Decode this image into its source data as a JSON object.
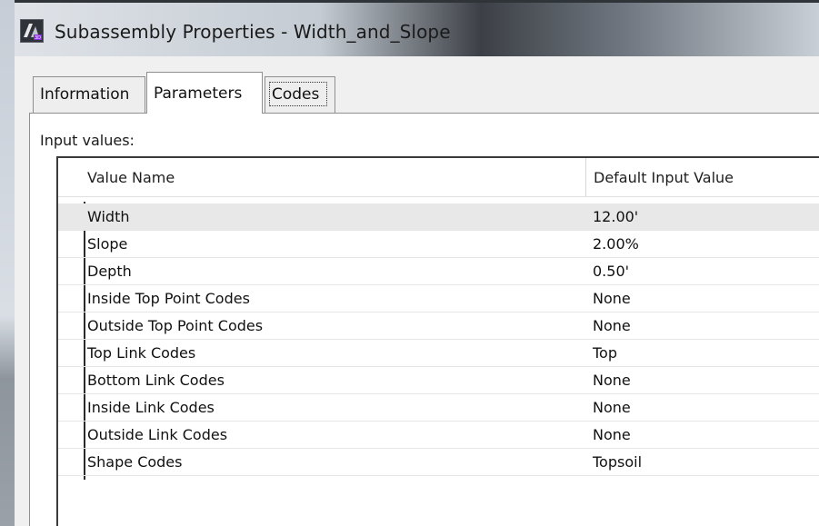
{
  "window": {
    "title": "Subassembly Properties - Width_and_Slope",
    "app_icon": "autocad-civil-icon"
  },
  "tabs": [
    {
      "label": "Information",
      "active": false
    },
    {
      "label": "Parameters",
      "active": true
    },
    {
      "label": "Codes",
      "active": false
    }
  ],
  "parameters": {
    "section_label": "Input values:",
    "columns": {
      "name": "Value Name",
      "value": "Default Input Value"
    },
    "rows": [
      {
        "name": "Width",
        "value": "12.00'",
        "selected": true
      },
      {
        "name": "Slope",
        "value": "2.00%",
        "selected": false
      },
      {
        "name": "Depth",
        "value": "0.50'",
        "selected": false
      },
      {
        "name": "Inside Top Point Codes",
        "value": "None",
        "selected": false
      },
      {
        "name": "Outside Top Point Codes",
        "value": "None",
        "selected": false
      },
      {
        "name": "Top Link Codes",
        "value": "Top",
        "selected": false
      },
      {
        "name": "Bottom Link Codes",
        "value": "None",
        "selected": false
      },
      {
        "name": "Inside Link Codes",
        "value": "None",
        "selected": false
      },
      {
        "name": "Outside Link Codes",
        "value": "None",
        "selected": false
      },
      {
        "name": "Shape Codes",
        "value": "Topsoil",
        "selected": false
      }
    ]
  }
}
